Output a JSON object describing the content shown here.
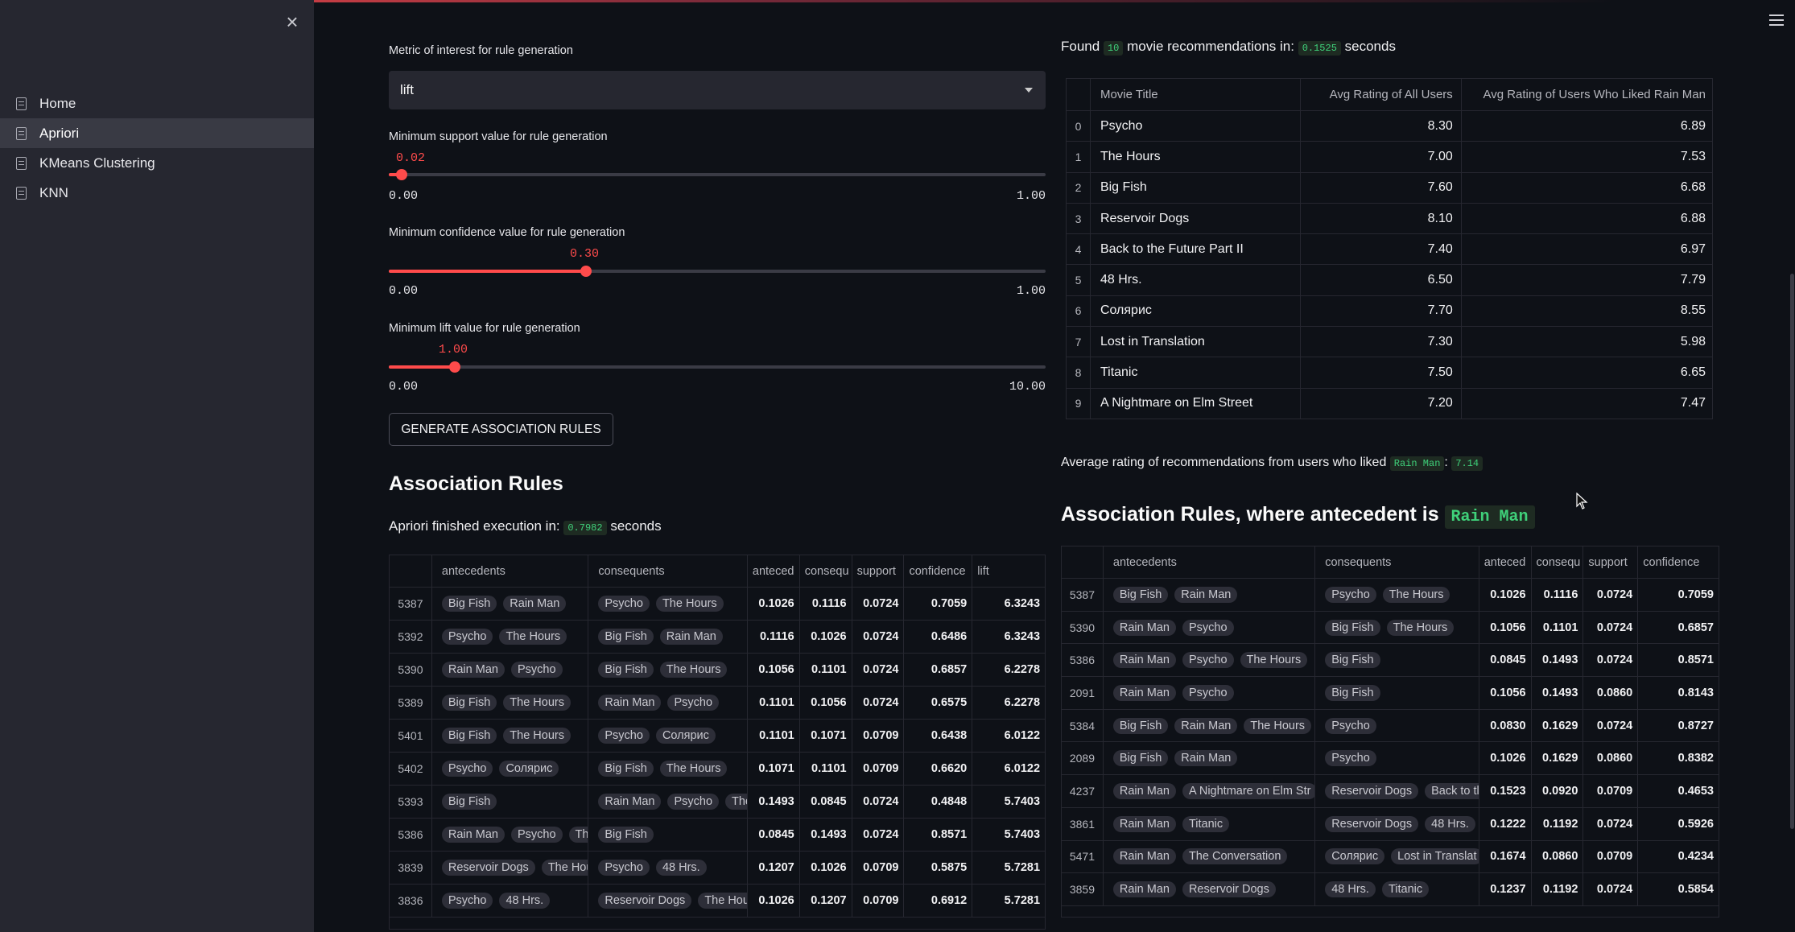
{
  "sidebar": {
    "items": [
      {
        "label": "Home"
      },
      {
        "label": "Apriori"
      },
      {
        "label": "KMeans Clustering"
      },
      {
        "label": "KNN"
      }
    ]
  },
  "controls": {
    "metric_label": "Metric of interest for rule generation",
    "metric_value": "lift",
    "support": {
      "label": "Minimum support value for rule generation",
      "value": "0.02",
      "min": "0.00",
      "max": "1.00",
      "fraction": 0.02
    },
    "confidence": {
      "label": "Minimum confidence value for rule generation",
      "value": "0.30",
      "min": "0.00",
      "max": "1.00",
      "fraction": 0.3
    },
    "lift": {
      "label": "Minimum lift value for rule generation",
      "value": "1.00",
      "min": "0.00",
      "max": "10.00",
      "fraction": 0.1
    },
    "generate_button": "GENERATE ASSOCIATION RULES"
  },
  "assoc": {
    "title": "Association Rules",
    "exec_prefix": "Apriori finished execution in:",
    "exec_time": "0.7982",
    "exec_suffix": "seconds",
    "columns": [
      "antecedents",
      "consequents",
      "anteced",
      "consequ",
      "support",
      "confidence",
      "lift"
    ],
    "rows": [
      {
        "idx": "5387",
        "ant": [
          "Big Fish",
          "Rain Man"
        ],
        "con": [
          "Psycho",
          "The Hours"
        ],
        "a": "0.1026",
        "c": "0.1116",
        "s": "0.0724",
        "conf": "0.7059",
        "lift": "6.3243"
      },
      {
        "idx": "5392",
        "ant": [
          "Psycho",
          "The Hours"
        ],
        "con": [
          "Big Fish",
          "Rain Man"
        ],
        "a": "0.1116",
        "c": "0.1026",
        "s": "0.0724",
        "conf": "0.6486",
        "lift": "6.3243"
      },
      {
        "idx": "5390",
        "ant": [
          "Rain Man",
          "Psycho"
        ],
        "con": [
          "Big Fish",
          "The Hours"
        ],
        "a": "0.1056",
        "c": "0.1101",
        "s": "0.0724",
        "conf": "0.6857",
        "lift": "6.2278"
      },
      {
        "idx": "5389",
        "ant": [
          "Big Fish",
          "The Hours"
        ],
        "con": [
          "Rain Man",
          "Psycho"
        ],
        "a": "0.1101",
        "c": "0.1056",
        "s": "0.0724",
        "conf": "0.6575",
        "lift": "6.2278"
      },
      {
        "idx": "5401",
        "ant": [
          "Big Fish",
          "The Hours"
        ],
        "con": [
          "Psycho",
          "Солярис"
        ],
        "a": "0.1101",
        "c": "0.1071",
        "s": "0.0709",
        "conf": "0.6438",
        "lift": "6.0122"
      },
      {
        "idx": "5402",
        "ant": [
          "Psycho",
          "Солярис"
        ],
        "con": [
          "Big Fish",
          "The Hours"
        ],
        "a": "0.1071",
        "c": "0.1101",
        "s": "0.0709",
        "conf": "0.6620",
        "lift": "6.0122"
      },
      {
        "idx": "5393",
        "ant": [
          "Big Fish"
        ],
        "con": [
          "Rain Man",
          "Psycho",
          "The"
        ],
        "a": "0.1493",
        "c": "0.0845",
        "s": "0.0724",
        "conf": "0.4848",
        "lift": "5.7403"
      },
      {
        "idx": "5386",
        "ant": [
          "Rain Man",
          "Psycho",
          "The"
        ],
        "con": [
          "Big Fish"
        ],
        "a": "0.0845",
        "c": "0.1493",
        "s": "0.0724",
        "conf": "0.8571",
        "lift": "5.7403"
      },
      {
        "idx": "3839",
        "ant": [
          "Reservoir Dogs",
          "The Hou"
        ],
        "con": [
          "Psycho",
          "48 Hrs."
        ],
        "a": "0.1207",
        "c": "0.1026",
        "s": "0.0709",
        "conf": "0.5875",
        "lift": "5.7281"
      },
      {
        "idx": "3836",
        "ant": [
          "Psycho",
          "48 Hrs."
        ],
        "con": [
          "Reservoir Dogs",
          "The Hou"
        ],
        "a": "0.1026",
        "c": "0.1207",
        "s": "0.0709",
        "conf": "0.6912",
        "lift": "5.7281"
      }
    ]
  },
  "recs": {
    "found_prefix": "Found",
    "found_count": "10",
    "found_middle": "movie recommendations in:",
    "found_time": "0.1525",
    "found_suffix": "seconds",
    "columns": [
      "Movie Title",
      "Avg Rating of All Users",
      "Avg Rating of Users Who Liked Rain Man"
    ],
    "rows": [
      {
        "idx": "0",
        "title": "Psycho",
        "all": "8.30",
        "liked": "6.89"
      },
      {
        "idx": "1",
        "title": "The Hours",
        "all": "7.00",
        "liked": "7.53"
      },
      {
        "idx": "2",
        "title": "Big Fish",
        "all": "7.60",
        "liked": "6.68"
      },
      {
        "idx": "3",
        "title": "Reservoir Dogs",
        "all": "8.10",
        "liked": "6.88"
      },
      {
        "idx": "4",
        "title": "Back to the Future Part II",
        "all": "7.40",
        "liked": "6.97"
      },
      {
        "idx": "5",
        "title": "48 Hrs.",
        "all": "6.50",
        "liked": "7.79"
      },
      {
        "idx": "6",
        "title": "Солярис",
        "all": "7.70",
        "liked": "8.55"
      },
      {
        "idx": "7",
        "title": "Lost in Translation",
        "all": "7.30",
        "liked": "5.98"
      },
      {
        "idx": "8",
        "title": "Titanic",
        "all": "7.50",
        "liked": "6.65"
      },
      {
        "idx": "9",
        "title": "A Nightmare on Elm Street",
        "all": "7.20",
        "liked": "7.47"
      }
    ],
    "avg_prefix": "Average rating of recommendations from users who liked",
    "avg_movie": "Rain Man",
    "avg_sep": ":",
    "avg_value": "7.14"
  },
  "antecedent": {
    "title_prefix": "Association Rules, where antecedent is",
    "title_movie": "Rain Man",
    "columns": [
      "antecedents",
      "consequents",
      "anteced",
      "consequ",
      "support",
      "confidence"
    ],
    "rows": [
      {
        "idx": "5387",
        "ant": [
          "Big Fish",
          "Rain Man"
        ],
        "con": [
          "Psycho",
          "The Hours"
        ],
        "a": "0.1026",
        "c": "0.1116",
        "s": "0.0724",
        "conf": "0.7059"
      },
      {
        "idx": "5390",
        "ant": [
          "Rain Man",
          "Psycho"
        ],
        "con": [
          "Big Fish",
          "The Hours"
        ],
        "a": "0.1056",
        "c": "0.1101",
        "s": "0.0724",
        "conf": "0.6857"
      },
      {
        "idx": "5386",
        "ant": [
          "Rain Man",
          "Psycho",
          "The Hours"
        ],
        "con": [
          "Big Fish"
        ],
        "a": "0.0845",
        "c": "0.1493",
        "s": "0.0724",
        "conf": "0.8571"
      },
      {
        "idx": "2091",
        "ant": [
          "Rain Man",
          "Psycho"
        ],
        "con": [
          "Big Fish"
        ],
        "a": "0.1056",
        "c": "0.1493",
        "s": "0.0860",
        "conf": "0.8143"
      },
      {
        "idx": "5384",
        "ant": [
          "Big Fish",
          "Rain Man",
          "The Hours"
        ],
        "con": [
          "Psycho"
        ],
        "a": "0.0830",
        "c": "0.1629",
        "s": "0.0724",
        "conf": "0.8727"
      },
      {
        "idx": "2089",
        "ant": [
          "Big Fish",
          "Rain Man"
        ],
        "con": [
          "Psycho"
        ],
        "a": "0.1026",
        "c": "0.1629",
        "s": "0.0860",
        "conf": "0.8382"
      },
      {
        "idx": "4237",
        "ant": [
          "Rain Man",
          "A Nightmare on Elm Str"
        ],
        "con": [
          "Reservoir Dogs",
          "Back to tl"
        ],
        "a": "0.1523",
        "c": "0.0920",
        "s": "0.0709",
        "conf": "0.4653"
      },
      {
        "idx": "3861",
        "ant": [
          "Rain Man",
          "Titanic"
        ],
        "con": [
          "Reservoir Dogs",
          "48 Hrs."
        ],
        "a": "0.1222",
        "c": "0.1192",
        "s": "0.0724",
        "conf": "0.5926"
      },
      {
        "idx": "5471",
        "ant": [
          "Rain Man",
          "The Conversation"
        ],
        "con": [
          "Солярис",
          "Lost in Translat"
        ],
        "a": "0.1674",
        "c": "0.0860",
        "s": "0.0709",
        "conf": "0.4234"
      },
      {
        "idx": "3859",
        "ant": [
          "Rain Man",
          "Reservoir Dogs"
        ],
        "con": [
          "48 Hrs.",
          "Titanic"
        ],
        "a": "0.1237",
        "c": "0.1192",
        "s": "0.0724",
        "conf": "0.5854"
      }
    ]
  }
}
